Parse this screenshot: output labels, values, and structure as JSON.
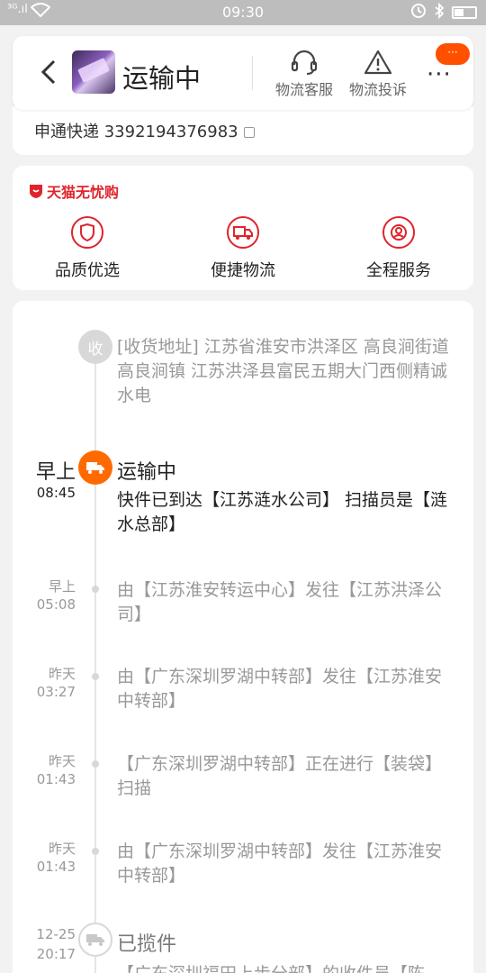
{
  "status_bar": {
    "signal": "³ᴳ.ıl",
    "time": "09:30",
    "icons": [
      "alarm-icon",
      "bluetooth-icon",
      "battery-icon"
    ]
  },
  "header": {
    "back_icon": "chevron-left-icon",
    "title": "运输中",
    "customer_service": "物流客服",
    "complaint": "物流投诉",
    "more": "···",
    "badge": "···"
  },
  "tracking": {
    "text": "申通快递 3392194376983"
  },
  "service": {
    "brand": "天猫无忧购",
    "items": [
      {
        "label": "品质优选",
        "icon": "shield-icon"
      },
      {
        "label": "便捷物流",
        "icon": "truck-icon"
      },
      {
        "label": "全程服务",
        "icon": "support-icon"
      }
    ]
  },
  "timeline": {
    "address_node": "收",
    "address": "[收货地址] 江苏省淮安市洪泽区 高良涧街道  高良涧镇 江苏洪泽县富民五期大门西侧精诚水电",
    "events": [
      {
        "day": "早上",
        "time": "08:45",
        "title": "运输中",
        "text": "快件已到达【江苏涟水公司】 扫描员是【涟水总部】"
      },
      {
        "day": "早上",
        "time": "05:08",
        "text": "由【江苏淮安转运中心】发往【江苏洪泽公司】"
      },
      {
        "day": "昨天",
        "time": "03:27",
        "text": "由【广东深圳罗湖中转部】发往【江苏淮安中转部】"
      },
      {
        "day": "昨天",
        "time": "01:43",
        "text": "【广东深圳罗湖中转部】正在进行【装袋】扫描"
      },
      {
        "day": "昨天",
        "time": "01:43",
        "text": "由【广东深圳罗湖中转部】发往【江苏淮安中转部】"
      },
      {
        "day": "12-25",
        "time": "20:17",
        "title": "已揽件",
        "text": "【广东深圳福田上步分部】的收件员【陈"
      }
    ]
  },
  "colors": {
    "accent": "#ff6a00",
    "brand_red": "#e0242c",
    "badge": "#ff5000"
  }
}
